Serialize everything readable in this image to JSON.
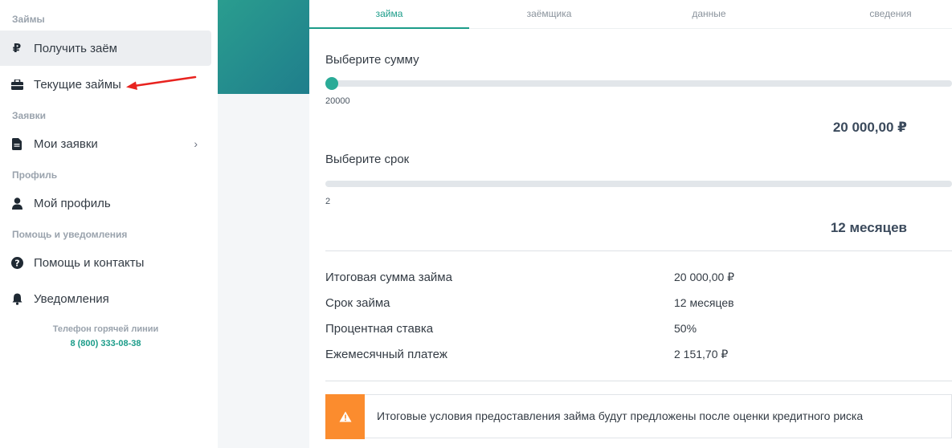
{
  "sidebar": {
    "sections": {
      "loans": "Займы",
      "applications": "Заявки",
      "profile": "Профиль",
      "help": "Помощь и уведомления"
    },
    "items": {
      "get_loan": {
        "label": "Получить заём",
        "icon": "ruble-icon"
      },
      "current_loans": {
        "label": "Текущие займы",
        "icon": "briefcase-icon"
      },
      "my_applications": {
        "label": "Мои заявки",
        "icon": "document-icon"
      },
      "my_profile": {
        "label": "Мой профиль",
        "icon": "user-icon"
      },
      "help_contacts": {
        "label": "Помощь и контакты",
        "icon": "question-icon"
      },
      "notifications": {
        "label": "Уведомления",
        "icon": "bell-icon"
      }
    },
    "hotline": {
      "label": "Телефон горячей линии",
      "phone": "8 (800) 333-08-38"
    }
  },
  "tabs": [
    {
      "label": "займа"
    },
    {
      "label": "заёмщика"
    },
    {
      "label": "данные"
    },
    {
      "label": "сведения"
    }
  ],
  "amount": {
    "label": "Выберите сумму",
    "min_label": "20000",
    "value_text": "20 000,00 ₽",
    "fraction": 0.0
  },
  "term": {
    "label": "Выберите срок",
    "min_label": "2",
    "value_text": "12 месяцев"
  },
  "summary": [
    {
      "label": "Итоговая сумма займа",
      "value": "20 000,00 ₽"
    },
    {
      "label": "Срок займа",
      "value": "12 месяцев"
    },
    {
      "label": "Процентная ставка",
      "value": "50%"
    },
    {
      "label": "Ежемесячный платеж",
      "value": "2 151,70 ₽"
    }
  ],
  "notice": {
    "text": "Итоговые условия предоставления займа будут предложены после оценки кредитного риска",
    "icon": "warning-icon"
  },
  "colors": {
    "accent": "#1b9c89",
    "warning": "#fb8c2e",
    "annotation": "#e8231f"
  }
}
